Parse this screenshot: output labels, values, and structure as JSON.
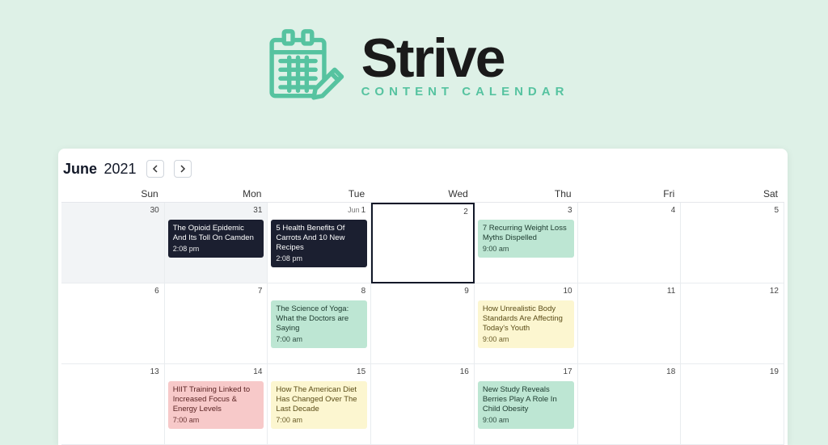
{
  "brand": {
    "title": "Strive",
    "subtitle": "CONTENT CALENDAR"
  },
  "calendar": {
    "month": "June",
    "year": "2021",
    "dow": [
      "Sun",
      "Mon",
      "Tue",
      "Wed",
      "Thu",
      "Fri",
      "Sat"
    ],
    "cells": [
      {
        "num": "30",
        "prev": true
      },
      {
        "num": "31",
        "prev": true,
        "events": [
          {
            "title": "The Opioid Epidemic And Its Toll On Camden",
            "time": "2:08 pm",
            "color": "dark"
          }
        ]
      },
      {
        "num": "1",
        "prefix": "Jun",
        "events": [
          {
            "title": "5 Health Benefits Of Carrots And 10 New Recipes",
            "time": "2:08 pm",
            "color": "dark"
          }
        ]
      },
      {
        "num": "2",
        "today": true
      },
      {
        "num": "3",
        "events": [
          {
            "title": "7 Recurring Weight Loss Myths Dispelled",
            "time": "9:00 am",
            "color": "green"
          }
        ]
      },
      {
        "num": "4"
      },
      {
        "num": "5"
      },
      {
        "num": "6"
      },
      {
        "num": "7"
      },
      {
        "num": "8",
        "events": [
          {
            "title": "The Science of Yoga: What the Doctors are Saying",
            "time": "7:00 am",
            "color": "green"
          }
        ]
      },
      {
        "num": "9"
      },
      {
        "num": "10",
        "events": [
          {
            "title": "How Unrealistic Body Standards Are Affecting Today's Youth",
            "time": "9:00 am",
            "color": "yellow"
          }
        ]
      },
      {
        "num": "11"
      },
      {
        "num": "12"
      },
      {
        "num": "13"
      },
      {
        "num": "14",
        "events": [
          {
            "title": "HIIT Training Linked to Increased Focus & Energy Levels",
            "time": "7:00 am",
            "color": "pink"
          }
        ]
      },
      {
        "num": "15",
        "events": [
          {
            "title": "How The American Diet Has Changed Over The Last Decade",
            "time": "7:00 am",
            "color": "yellow"
          }
        ]
      },
      {
        "num": "16"
      },
      {
        "num": "17",
        "events": [
          {
            "title": "New Study Reveals Berries Play A Role In Child Obesity",
            "time": "9:00 am",
            "color": "green"
          }
        ]
      },
      {
        "num": "18"
      },
      {
        "num": "19"
      }
    ]
  }
}
